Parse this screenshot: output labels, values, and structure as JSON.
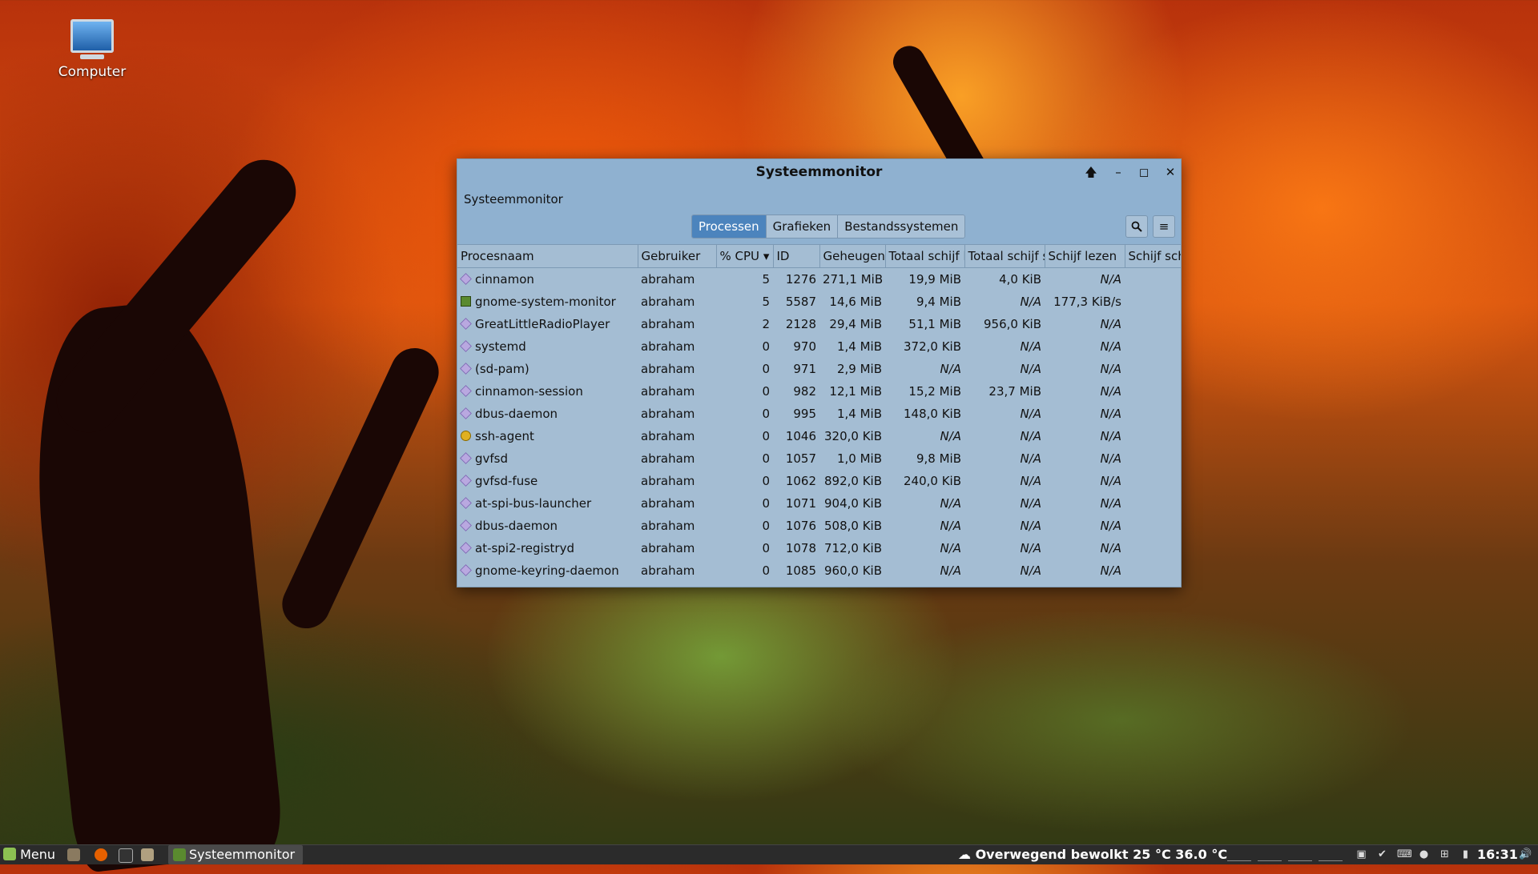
{
  "desktop": {
    "icon_label": "Computer"
  },
  "window": {
    "title": "Systeemmonitor",
    "menu_app": "Systeemmonitor",
    "buttons": {
      "pin": "🡅",
      "minimize": "–",
      "maximize": "◻",
      "close": "✕"
    },
    "tabs": [
      "Processen",
      "Grafieken",
      "Bestandssystemen"
    ],
    "active_tab": "Processen",
    "columns": [
      "Procesnaam",
      "Gebruiker",
      "% CPU",
      "ID",
      "Geheugen",
      "Totaal schijf l",
      "Totaal schijf s",
      "Schijf lezen",
      "Schijf sch"
    ],
    "sort_indicator": "▾",
    "rows": [
      {
        "icon": "diamond",
        "name": "cinnamon",
        "user": "abraham",
        "cpu": "5",
        "id": "1276",
        "mem": "271,1 MiB",
        "tread": "19,9 MiB",
        "twrite": "4,0 KiB",
        "read": "N/A"
      },
      {
        "icon": "gsm",
        "name": "gnome-system-monitor",
        "user": "abraham",
        "cpu": "5",
        "id": "5587",
        "mem": "14,6 MiB",
        "tread": "9,4 MiB",
        "twrite": "N/A",
        "read": "177,3 KiB/s"
      },
      {
        "icon": "diamond",
        "name": "GreatLittleRadioPlayer",
        "user": "abraham",
        "cpu": "2",
        "id": "2128",
        "mem": "29,4 MiB",
        "tread": "51,1 MiB",
        "twrite": "956,0 KiB",
        "read": "N/A"
      },
      {
        "icon": "diamond",
        "name": "systemd",
        "user": "abraham",
        "cpu": "0",
        "id": "970",
        "mem": "1,4 MiB",
        "tread": "372,0 KiB",
        "twrite": "N/A",
        "read": "N/A"
      },
      {
        "icon": "diamond",
        "name": "(sd-pam)",
        "user": "abraham",
        "cpu": "0",
        "id": "971",
        "mem": "2,9 MiB",
        "tread": "N/A",
        "twrite": "N/A",
        "read": "N/A"
      },
      {
        "icon": "diamond",
        "name": "cinnamon-session",
        "user": "abraham",
        "cpu": "0",
        "id": "982",
        "mem": "12,1 MiB",
        "tread": "15,2 MiB",
        "twrite": "23,7 MiB",
        "read": "N/A"
      },
      {
        "icon": "diamond",
        "name": "dbus-daemon",
        "user": "abraham",
        "cpu": "0",
        "id": "995",
        "mem": "1,4 MiB",
        "tread": "148,0 KiB",
        "twrite": "N/A",
        "read": "N/A"
      },
      {
        "icon": "ssh",
        "name": "ssh-agent",
        "user": "abraham",
        "cpu": "0",
        "id": "1046",
        "mem": "320,0 KiB",
        "tread": "N/A",
        "twrite": "N/A",
        "read": "N/A"
      },
      {
        "icon": "diamond",
        "name": "gvfsd",
        "user": "abraham",
        "cpu": "0",
        "id": "1057",
        "mem": "1,0 MiB",
        "tread": "9,8 MiB",
        "twrite": "N/A",
        "read": "N/A"
      },
      {
        "icon": "diamond",
        "name": "gvfsd-fuse",
        "user": "abraham",
        "cpu": "0",
        "id": "1062",
        "mem": "892,0 KiB",
        "tread": "240,0 KiB",
        "twrite": "N/A",
        "read": "N/A"
      },
      {
        "icon": "diamond",
        "name": "at-spi-bus-launcher",
        "user": "abraham",
        "cpu": "0",
        "id": "1071",
        "mem": "904,0 KiB",
        "tread": "N/A",
        "twrite": "N/A",
        "read": "N/A"
      },
      {
        "icon": "diamond",
        "name": "dbus-daemon",
        "user": "abraham",
        "cpu": "0",
        "id": "1076",
        "mem": "508,0 KiB",
        "tread": "N/A",
        "twrite": "N/A",
        "read": "N/A"
      },
      {
        "icon": "diamond",
        "name": "at-spi2-registryd",
        "user": "abraham",
        "cpu": "0",
        "id": "1078",
        "mem": "712,0 KiB",
        "tread": "N/A",
        "twrite": "N/A",
        "read": "N/A"
      },
      {
        "icon": "diamond",
        "name": "gnome-keyring-daemon",
        "user": "abraham",
        "cpu": "0",
        "id": "1085",
        "mem": "960,0 KiB",
        "tread": "N/A",
        "twrite": "N/A",
        "read": "N/A"
      }
    ]
  },
  "taskbar": {
    "menu_label": "Menu",
    "task_label": "Systeemmonitor",
    "weather": "Overwegend bewolkt 25 °C 36.0 °C",
    "clock": "16:31"
  },
  "colors": {
    "window_bg": "#a4bdd3",
    "active_tab": "#4c84bd",
    "taskbar_bg": "#2b2b2b"
  }
}
